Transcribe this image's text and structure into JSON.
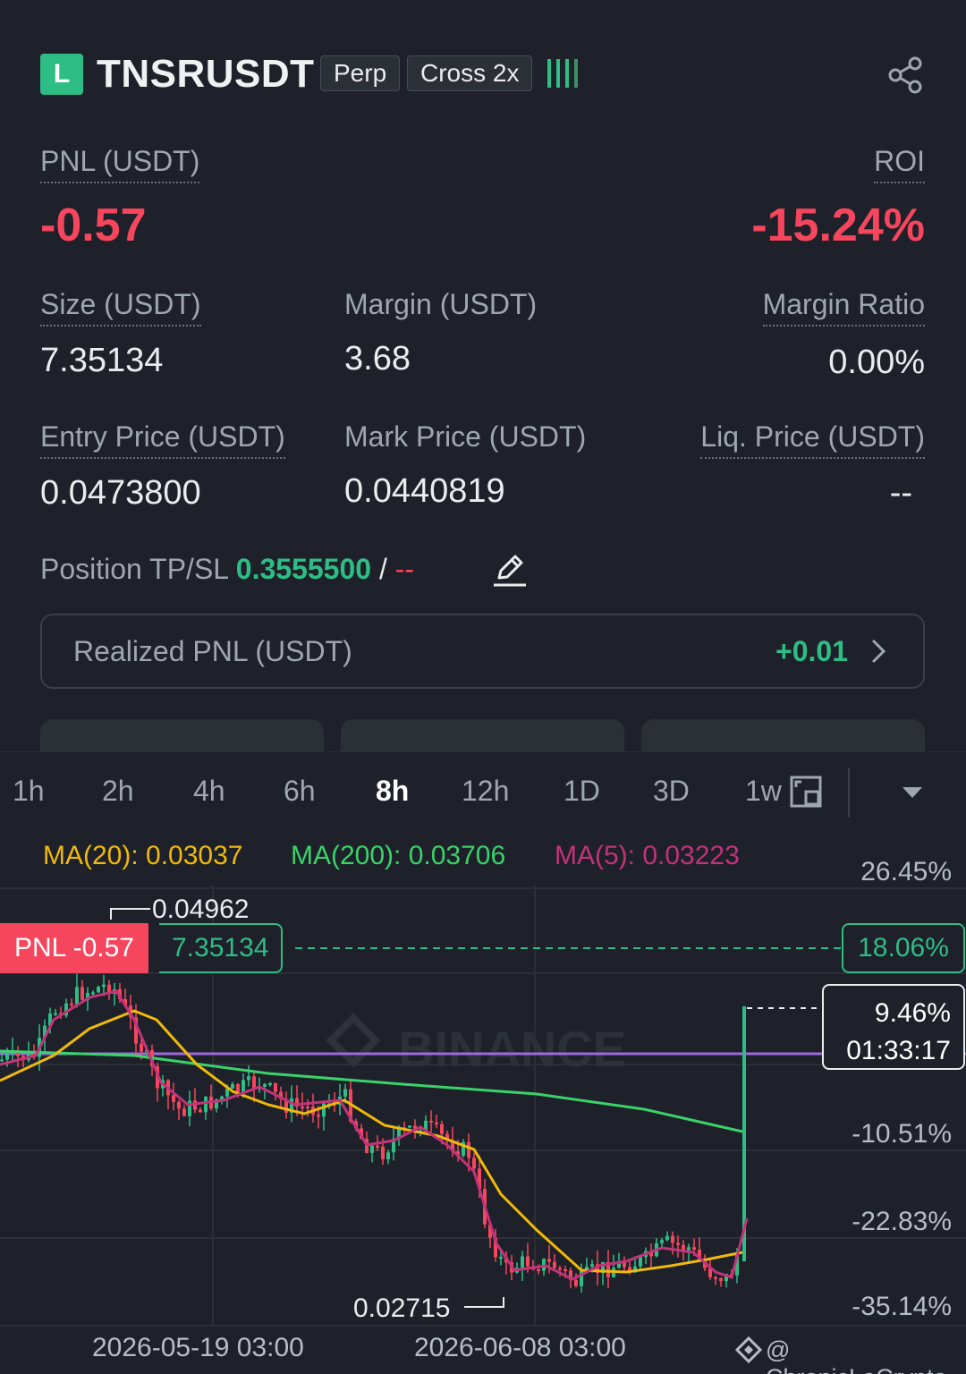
{
  "header": {
    "side_badge": "L",
    "symbol": "TNSRUSDT",
    "tag_type": "Perp",
    "tag_margin": "Cross 2x",
    "share_icon": "share-icon"
  },
  "pnl": {
    "label": "PNL (USDT)",
    "value": "-0.57"
  },
  "roi": {
    "label": "ROI",
    "value": "-15.24%"
  },
  "stats": {
    "size_label": "Size (USDT)",
    "size_value": "7.35134",
    "margin_label": "Margin (USDT)",
    "margin_value": "3.68",
    "margin_ratio_label": "Margin Ratio",
    "margin_ratio_value": "0.00%",
    "entry_label": "Entry Price (USDT)",
    "entry_value": "0.0473800",
    "mark_label": "Mark Price (USDT)",
    "mark_value": "0.0440819",
    "liq_label": "Liq. Price (USDT)",
    "liq_value": "--"
  },
  "tpsl": {
    "label": "Position TP/SL",
    "tp": "0.3555500",
    "sep": "/",
    "sl": "--"
  },
  "realized": {
    "label": "Realized PNL (USDT)",
    "value": "+0.01"
  },
  "timeframes": [
    "1h",
    "2h",
    "4h",
    "6h",
    "8h",
    "12h",
    "1D",
    "3D",
    "1w"
  ],
  "active_timeframe": "8h",
  "indicators": {
    "ma20": "MA(20): 0.03037",
    "ma200": "MA(200): 0.03706",
    "ma5": "MA(5): 0.03223"
  },
  "chart": {
    "high_label": "0.04962",
    "low_label": "0.02715",
    "pnl_tag": "PNL -0.57",
    "size_tag": "7.35134",
    "roi_tag": "18.06%",
    "current_pct": "9.46%",
    "countdown": "01:33:17",
    "y_labels": [
      "26.45%",
      "-10.51%",
      "-22.83%",
      "-35.14%"
    ],
    "x_labels": [
      "2026-05-19 03:00",
      "2026-06-08 03:00"
    ],
    "watermark": "BINANCE",
    "credit": "@ ChronicLeCrypto",
    "colors": {
      "up": "#2ebd85",
      "down": "#f6465d",
      "ma20": "#f0b90b",
      "ma200": "#3ad26a",
      "ma5": "#c2337a",
      "entry_line": "#9c6ade"
    }
  },
  "chart_data": {
    "type": "candlestick",
    "xlabels": [
      "2026-05-19 03:00",
      "2026-06-08 03:00"
    ],
    "y_axis_percent_labels": [
      "26.45%",
      "-10.51%",
      "-22.83%",
      "-35.14%"
    ],
    "high": 0.04962,
    "low": 0.02715,
    "ma": [
      {
        "name": "MA(20)",
        "value": 0.03037
      },
      {
        "name": "MA(200)",
        "value": 0.03706
      },
      {
        "name": "MA(5)",
        "value": 0.03223
      }
    ]
  }
}
